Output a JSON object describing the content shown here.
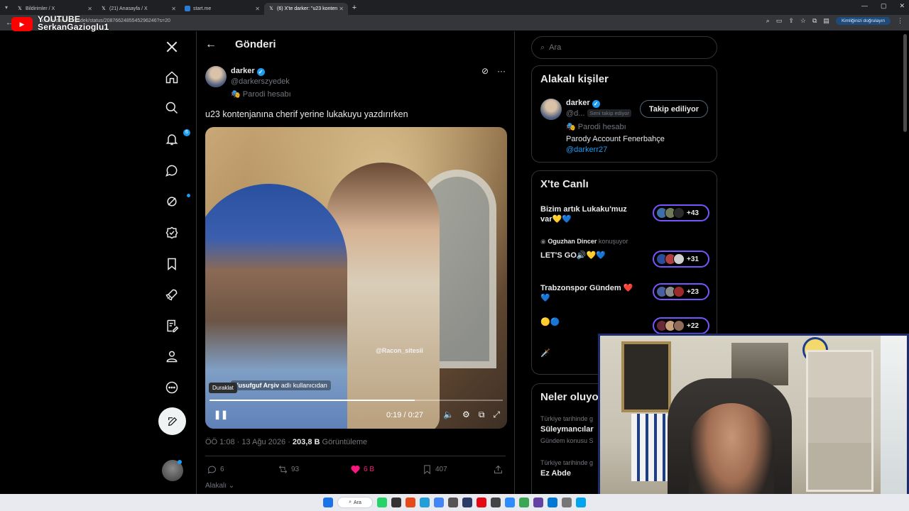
{
  "browser": {
    "tabs": [
      {
        "label": "Bildirimler / X",
        "active": false
      },
      {
        "label": "(21) Anasayfa / X",
        "active": false
      },
      {
        "label": "start.me",
        "active": false
      },
      {
        "label": "(6) X'te darker: \"u23 konten",
        "active": true
      }
    ],
    "url": "x.com/darkerszyedek/status/2087662485545296246?s=20",
    "verify_label": "Kimliğinizi doğrulayın"
  },
  "overlay": {
    "line1": "YOUTUBE",
    "line2": "SerkanGazioglu1"
  },
  "nav": {
    "notification_count": "6"
  },
  "main": {
    "title": "Gönderi",
    "author_name": "darker",
    "author_handle": "@darkerszyedek",
    "parody_label": "Parodi hesabı",
    "tweet_text": "u23 kontenjanına cherif yerine lukakuyu yazdırırken",
    "video": {
      "watermark": "@Racon_sitesii",
      "credit_name": "Yusufguf Arşiv",
      "credit_suffix": "adlı kullanıcıdan",
      "tooltip": "Duraklat",
      "time": "0:19 / 0:27",
      "progress": 0.7
    },
    "meta_time": "ÖÖ 1:08 · 13 Ağu 2026 · ",
    "meta_views": "203,8 B",
    "meta_views_label": " Görüntüleme",
    "actions": {
      "replies": "6",
      "reposts": "93",
      "likes": "6 B",
      "bookmarks": "407"
    },
    "related": "Alakalı"
  },
  "right": {
    "search_placeholder": "Ara",
    "related_people": {
      "title": "Alakalı kişiler",
      "name": "darker",
      "handle": "@d...",
      "follows_you": "Seni takip ediyor",
      "follow_button": "Takip ediliyor",
      "parody_label": "Parodi hesabı",
      "bio": "Parody Account Fenerbahçe",
      "link": "@darkerr27"
    },
    "live": {
      "title": "X'te Canlı",
      "items": [
        {
          "title": "Bizim artık Lukaku'muz var💛💙",
          "count": "+43"
        },
        {
          "host": "Oguzhan Dincer",
          "host_suffix": "konuşuyor",
          "title": "LET'S GO🔊💛💙",
          "count": "+31"
        },
        {
          "title": "Trabzonspor Gündem ❤️💙",
          "count": "+23"
        },
        {
          "title": "🟡🔵",
          "count": "+22"
        },
        {
          "title": "🗡️"
        }
      ]
    },
    "trends": {
      "title": "Neler oluyo",
      "items": [
        {
          "category": "Türkiye tarihinde g",
          "name": "Süleymancılar",
          "sub": "Gündem konusu S"
        },
        {
          "category": "Türkiye tarihinde g",
          "name": "Ez Abde"
        }
      ]
    }
  },
  "taskbar": {
    "search_label": "Ara"
  },
  "colors": {
    "accent": "#1d9bf0",
    "like": "#f91880",
    "live_border": "#7856ff"
  }
}
